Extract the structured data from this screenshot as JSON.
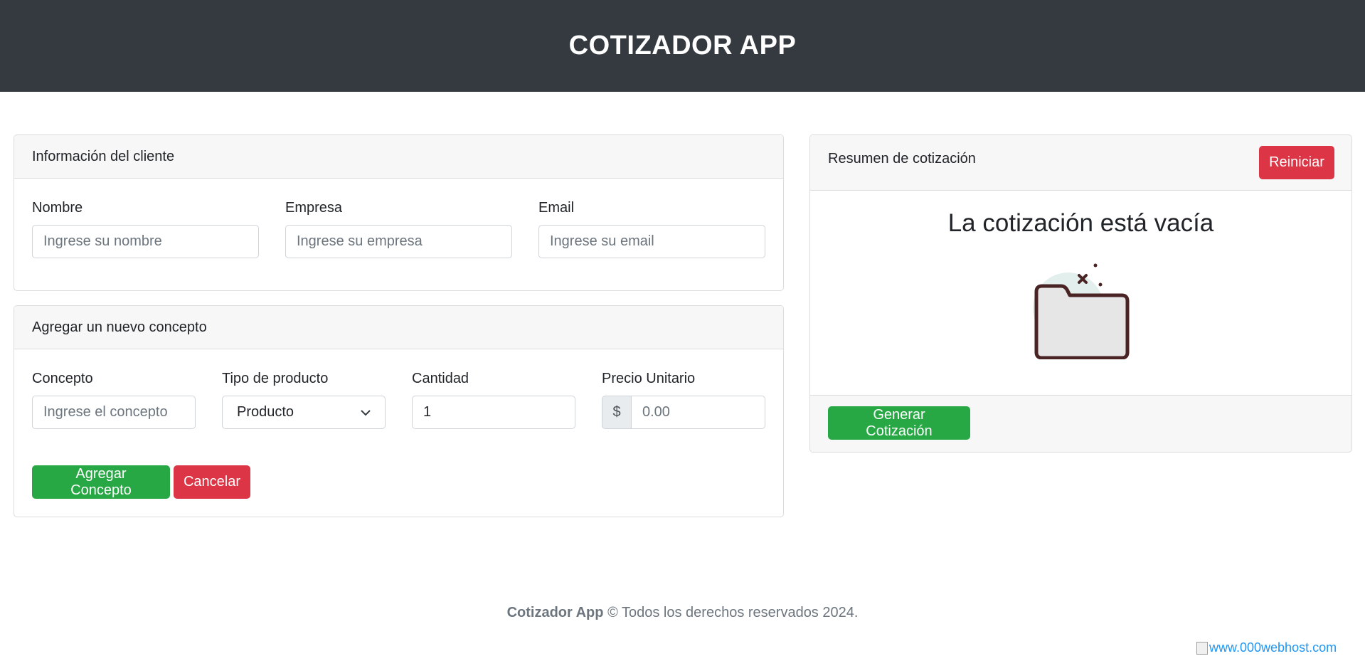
{
  "header": {
    "title": "COTIZADOR APP"
  },
  "client_info": {
    "title": "Información del cliente",
    "fields": [
      {
        "label": "Nombre",
        "placeholder": "Ingrese su nombre"
      },
      {
        "label": "Empresa",
        "placeholder": "Ingrese su empresa"
      },
      {
        "label": "Email",
        "placeholder": "Ingrese su email"
      }
    ]
  },
  "new_concept": {
    "title": "Agregar un nuevo concepto",
    "concept": {
      "label": "Concepto",
      "placeholder": "Ingrese el concepto"
    },
    "product_type": {
      "label": "Tipo de producto",
      "value": "Producto"
    },
    "quantity": {
      "label": "Cantidad",
      "value": "1"
    },
    "unit_price": {
      "label": "Precio Unitario",
      "prefix": "$",
      "placeholder": "0.00"
    },
    "add_button": "Agregar Concepto",
    "cancel_button": "Cancelar"
  },
  "summary": {
    "title": "Resumen de cotización",
    "reset_button": "Reiniciar",
    "empty_message": "La cotización está vacía",
    "empty_icon": "empty-folder-icon",
    "generate_button": "Generar Cotización"
  },
  "footer": {
    "brand": "Cotizador App",
    "rights": "© Todos los derechos reservados 2024.",
    "host_link": "www.000webhost.com"
  },
  "colors": {
    "header_bg": "#343a40",
    "success": "#28a745",
    "danger": "#dc3545"
  }
}
